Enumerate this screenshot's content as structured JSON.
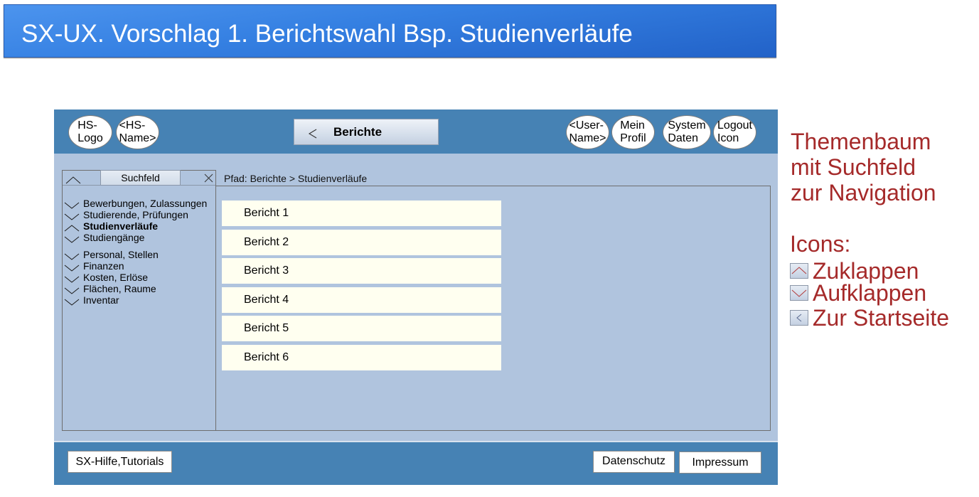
{
  "title": "SX-UX. Vorschlag 1. Berichtswahl Bsp. Studienverläufe",
  "header": {
    "bubbles_left": [
      {
        "lines": [
          "HS-",
          "Logo"
        ]
      },
      {
        "lines": [
          "<HS-",
          "Name>"
        ]
      }
    ],
    "home_button": {
      "icon": "chevron-left-icon",
      "label": "Berichte"
    },
    "bubbles_right": [
      {
        "lines": [
          "<User-",
          "Name>"
        ]
      },
      {
        "lines": [
          "Mein",
          "Profil"
        ]
      },
      {
        "lines": [
          "System",
          "Daten"
        ]
      },
      {
        "lines": [
          "Logout",
          "Icon"
        ]
      }
    ]
  },
  "sidebar": {
    "collapse_icon": "chevron-up-icon",
    "search_label": "Suchfeld",
    "close_icon": "close-icon",
    "tree": [
      {
        "label": "Bewerbungen, Zulassungen",
        "icon": "chevron-down-icon",
        "expanded": false,
        "selected": false
      },
      {
        "label": "Studierende, Prüfungen",
        "icon": "chevron-down-icon",
        "expanded": false,
        "selected": false
      },
      {
        "label": "Studienverläufe",
        "icon": "chevron-up-icon",
        "expanded": true,
        "selected": true
      },
      {
        "label": "Studiengänge",
        "icon": "chevron-down-icon",
        "expanded": false,
        "selected": false
      },
      {
        "label": "Personal, Stellen",
        "icon": "chevron-down-icon",
        "expanded": false,
        "selected": false
      },
      {
        "label": "Finanzen",
        "icon": "chevron-down-icon",
        "expanded": false,
        "selected": false
      },
      {
        "label": "Kosten, Erlöse",
        "icon": "chevron-down-icon",
        "expanded": false,
        "selected": false
      },
      {
        "label": "Flächen, Raume",
        "icon": "chevron-down-icon",
        "expanded": false,
        "selected": false
      },
      {
        "label": "Inventar",
        "icon": "chevron-down-icon",
        "expanded": false,
        "selected": false
      }
    ]
  },
  "breadcrumb": "Pfad: Berichte > Studienverläufe",
  "reports": [
    "Bericht 1",
    "Bericht 2",
    "Bericht 3",
    "Bericht 4",
    "Bericht 5",
    "Bericht 6"
  ],
  "footer": {
    "help_label": "SX-Hilfe,Tutorials",
    "privacy_label": "Datenschutz",
    "imprint_label": "Impressum"
  },
  "annotations": {
    "heading_lines": [
      "Themenbaum",
      "mit Suchfeld",
      "zur Navigation"
    ],
    "icons_label": "Icons:",
    "legend": [
      {
        "icon": "chevron-up-icon",
        "label": "Zuklappen"
      },
      {
        "icon": "chevron-down-icon",
        "label": "Aufklappen"
      },
      {
        "icon": "chevron-left-icon",
        "label": "Zur Startseite"
      }
    ]
  },
  "colors": {
    "banner_top": "#4c94ee",
    "banner_bottom": "#2262c8",
    "frame_bar": "#4682b4",
    "frame_body": "#b0c4de",
    "report_item": "#fffff0",
    "annotation_text": "#a52a2a",
    "annotation_icon_stroke": "#b23a3a"
  }
}
